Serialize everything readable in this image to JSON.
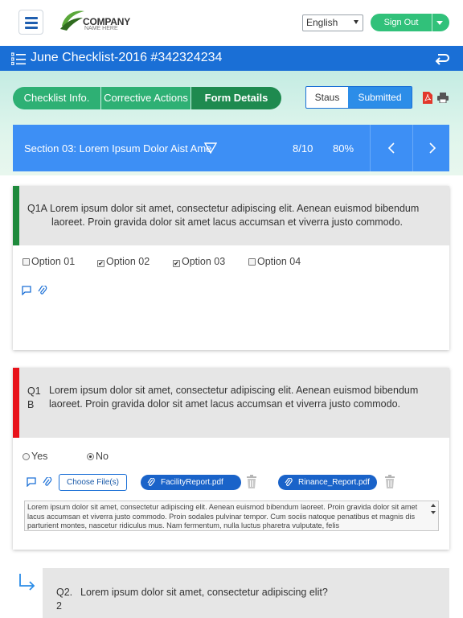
{
  "header": {
    "logo_name": "COMPANY",
    "logo_tagline": "NAME HERE",
    "language": "English",
    "signout_label": "Sign Out"
  },
  "titlebar": {
    "title": "June Checklist-2016 #342324234"
  },
  "tabs": [
    {
      "label": "Checklist Info."
    },
    {
      "label": "Corrective Actions"
    },
    {
      "label": "Form Details"
    }
  ],
  "status": {
    "label": "Staus",
    "value": "Submitted"
  },
  "section": {
    "name": "Section 03: Lorem Ipsum Dolor Aist Ame",
    "count": "8/10",
    "percent": "80%"
  },
  "questions": [
    {
      "number": "Q1A",
      "text": "Lorem ipsum dolor sit amet, consectetur adipiscing elit. Aenean euismod bibendum laoreet. Proin gravida dolor sit amet lacus accumsan et viverra justo commodo.",
      "options": [
        {
          "label": "Option 01",
          "checked": false
        },
        {
          "label": "Option 02",
          "checked": true
        },
        {
          "label": "Option 03",
          "checked": true
        },
        {
          "label": "Option 04",
          "checked": false
        }
      ],
      "accent_color": "#1e8a3c"
    },
    {
      "number_line1": "Q1",
      "number_line2": "B",
      "text": "Lorem ipsum dolor sit amet, consectetur adipiscing elit. Aenean euismod bibendum laoreet. Proin gravida dolor sit amet lacus accumsan et viverra justo commodo.",
      "radio": [
        {
          "label": "Yes",
          "selected": false
        },
        {
          "label": "No",
          "selected": true
        }
      ],
      "choose_label": "Choose File(s)",
      "files": [
        "FacilityReport.pdf",
        "Rinance_Report.pdf"
      ],
      "notes": "Lorem ipsum dolor sit amet, consectetur adipiscing elit. Aenean euismod bibendum laoreet. Proin gravida dolor sit amet lacus accumsan et viverra justo commodo. Proin sodales pulvinar tempor. Cum sociis natoque penatibus et magnis dis parturient montes, nascetur ridiculus mus. Nam fermentum, nulla luctus pharetra vulputate, felis",
      "accent_color": "#e8121a"
    },
    {
      "number_line1": "Q2.",
      "number_line2": "2",
      "text": "Lorem ipsum dolor sit amet, consectetur adipiscing elit?"
    }
  ],
  "colors": {
    "primary_blue": "#1a6fd6",
    "section_blue": "#3d8ff5",
    "green": "#2eb074",
    "green_active": "#1e8a4f"
  },
  "icons": [
    "menu-icon",
    "checklist-icon",
    "back-icon",
    "pdf-icon",
    "print-icon",
    "chevron-left-icon",
    "chevron-right-icon",
    "comment-icon",
    "attach-icon",
    "trash-icon",
    "subquestion-arrow-icon"
  ]
}
